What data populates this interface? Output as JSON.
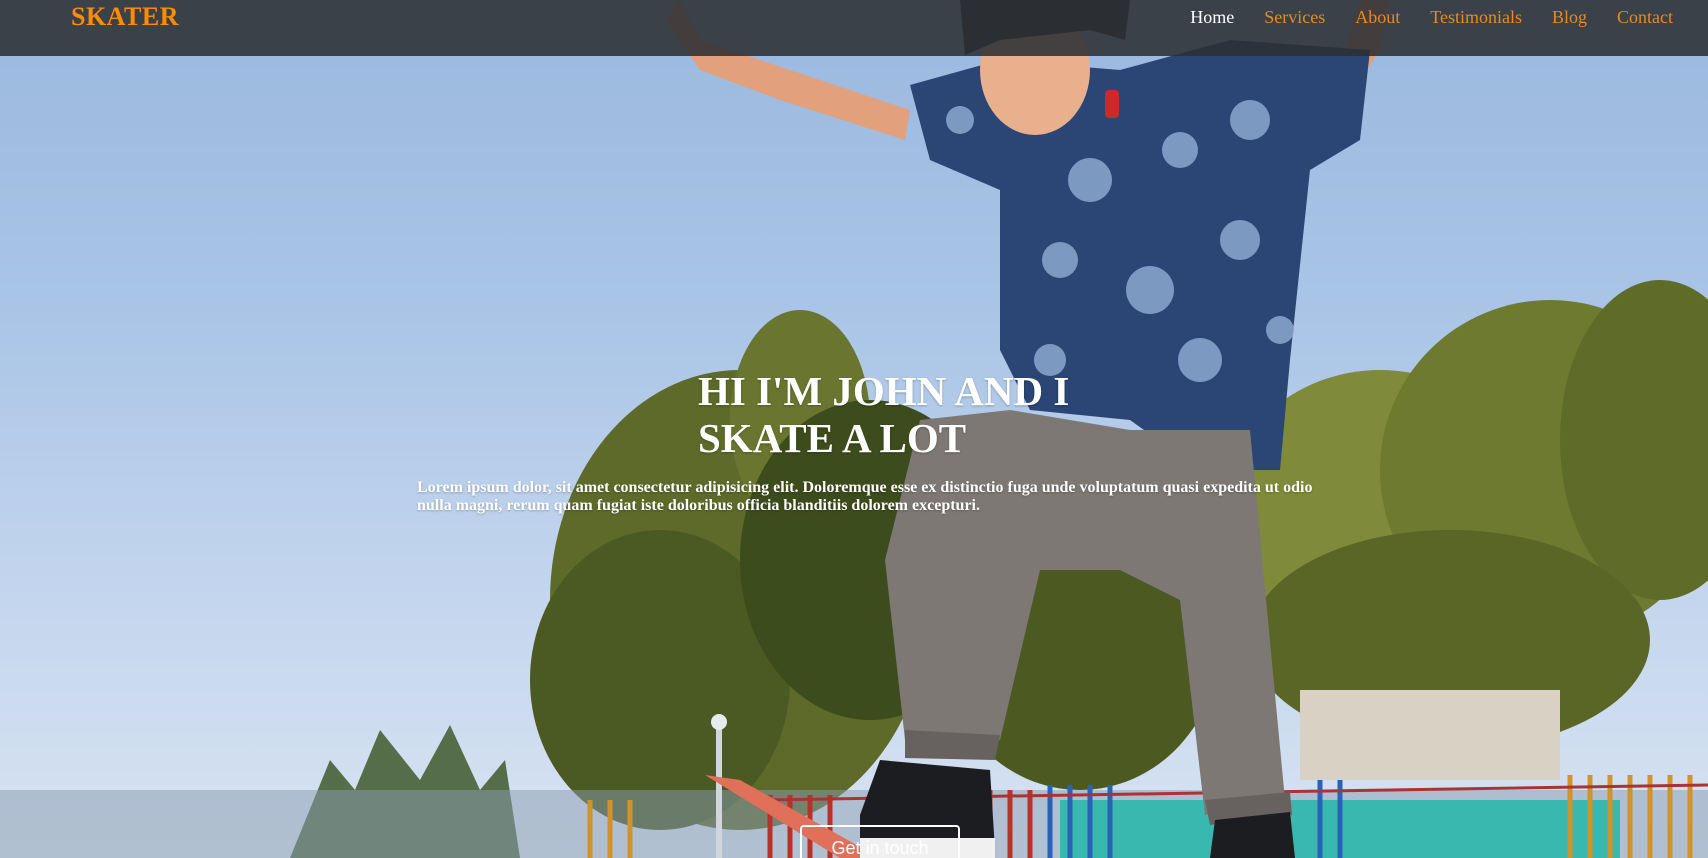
{
  "header": {
    "brand": "SKATER",
    "nav": [
      {
        "label": "Home",
        "active": true
      },
      {
        "label": "Services",
        "active": false
      },
      {
        "label": "About",
        "active": false
      },
      {
        "label": "Testimonials",
        "active": false
      },
      {
        "label": "Blog",
        "active": false
      },
      {
        "label": "Contact",
        "active": false
      }
    ]
  },
  "hero": {
    "headline": "HI I'M JOHN AND I SKATE A LOT",
    "lead": "Lorem ipsum dolor, sit amet consectetur adipisicing elit. Doloremque esse ex distinctio fuga unde voluptatum quasi expedita ut odio nulla magni, rerum quam fugiat iste doloribus officia blanditiis dolorem excepturi.",
    "cta_label": "Get in touch"
  },
  "colors": {
    "brand": "#ff8c00",
    "nav_link": "#e98a1c",
    "nav_active": "#ffffff",
    "navbar_bg": "#2c3034"
  }
}
